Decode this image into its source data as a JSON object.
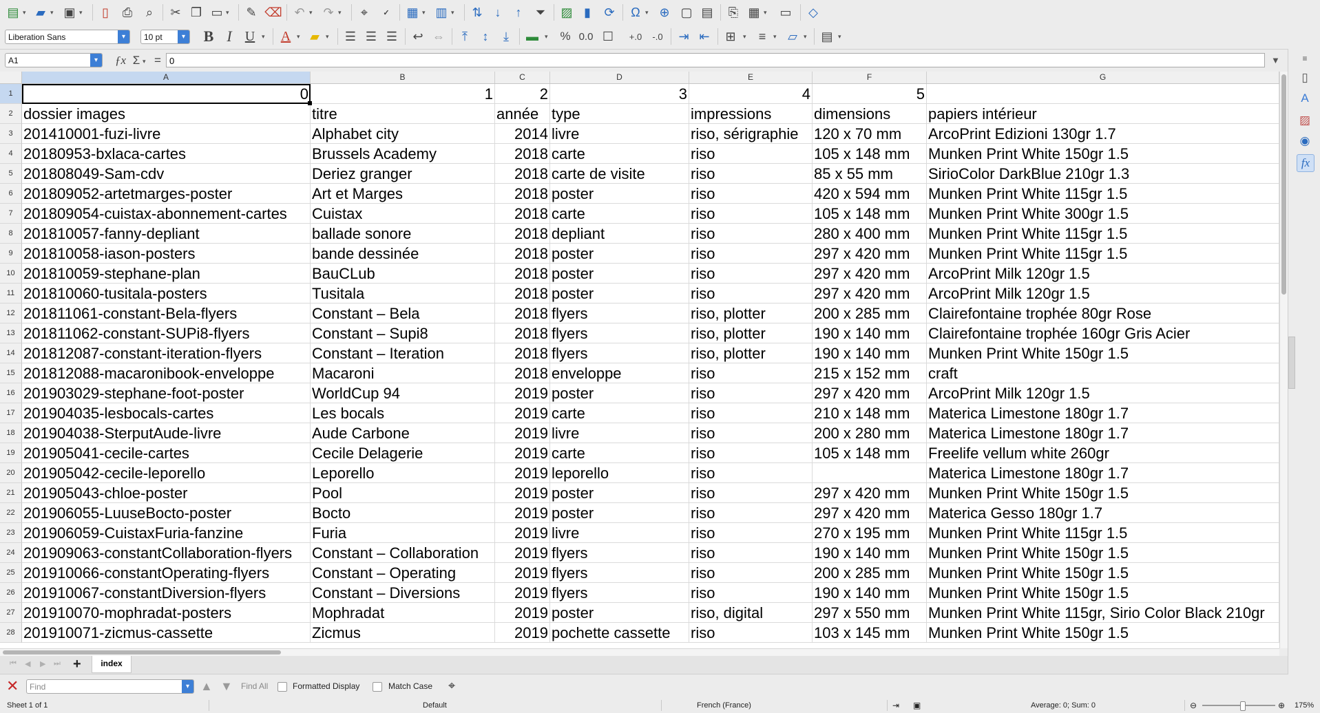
{
  "toolbar2": {
    "font_name": "Liberation Sans",
    "font_size": "10 pt"
  },
  "formula_bar": {
    "name_box": "A1",
    "content": "0"
  },
  "columns": [
    "A",
    "B",
    "C",
    "D",
    "E",
    "F",
    "G"
  ],
  "rows": [
    {
      "n": "1",
      "c": [
        "0",
        "1",
        "2",
        "3",
        "4",
        "5",
        ""
      ]
    },
    {
      "n": "2",
      "c": [
        "dossier images",
        "titre",
        "année",
        "type",
        "impressions",
        "dimensions",
        "papiers intérieur"
      ]
    },
    {
      "n": "3",
      "c": [
        "201410001-fuzi-livre",
        "Alphabet city",
        "2014",
        "livre",
        "riso, sérigraphie",
        "120 x 70 mm",
        "ArcoPrint Edizioni 130gr 1.7"
      ]
    },
    {
      "n": "4",
      "c": [
        "20180953-bxlaca-cartes",
        "Brussels Academy",
        "2018",
        "carte",
        "riso",
        "105 x 148 mm",
        "Munken Print White 150gr 1.5"
      ]
    },
    {
      "n": "5",
      "c": [
        "201808049-Sam-cdv",
        "Deriez granger",
        "2018",
        "carte de visite",
        "riso",
        "85 x 55 mm",
        "SirioColor DarkBlue 210gr 1.3"
      ]
    },
    {
      "n": "6",
      "c": [
        "201809052-artetmarges-poster",
        "Art et Marges",
        "2018",
        "poster",
        "riso",
        "420 x 594 mm",
        "Munken Print White 115gr 1.5"
      ]
    },
    {
      "n": "7",
      "c": [
        "201809054-cuistax-abonnement-cartes",
        "Cuistax",
        "2018",
        "carte",
        "riso",
        "105 x 148 mm",
        "Munken Print White 300gr 1.5"
      ]
    },
    {
      "n": "8",
      "c": [
        "201810057-fanny-depliant",
        "ballade sonore",
        "2018",
        "depliant",
        "riso",
        "280 x 400 mm",
        "Munken Print White 115gr 1.5"
      ]
    },
    {
      "n": "9",
      "c": [
        "201810058-iason-posters",
        "bande dessinée",
        "2018",
        "poster",
        "riso",
        "297 x 420 mm",
        "Munken Print White 115gr 1.5"
      ]
    },
    {
      "n": "10",
      "c": [
        "201810059-stephane-plan",
        "BauCLub",
        "2018",
        "poster",
        "riso",
        "297 x 420 mm",
        "ArcoPrint Milk 120gr 1.5"
      ]
    },
    {
      "n": "11",
      "c": [
        "201810060-tusitala-posters",
        "Tusitala",
        "2018",
        "poster",
        "riso",
        "297 x 420 mm",
        "ArcoPrint Milk 120gr 1.5"
      ]
    },
    {
      "n": "12",
      "c": [
        "201811061-constant-Bela-flyers",
        "Constant – Bela",
        "2018",
        "flyers",
        "riso, plotter",
        "200 x 285 mm",
        "Clairefontaine trophée 80gr Rose"
      ]
    },
    {
      "n": "13",
      "c": [
        "201811062-constant-SUPi8-flyers",
        "Constant – Supi8",
        "2018",
        "flyers",
        "riso, plotter",
        "190 x 140 mm",
        "Clairefontaine trophée 160gr Gris Acier"
      ]
    },
    {
      "n": "14",
      "c": [
        "201812087-constant-iteration-flyers",
        "Constant – Iteration",
        "2018",
        "flyers",
        "riso, plotter",
        "190 x 140 mm",
        "Munken Print White 150gr 1.5"
      ]
    },
    {
      "n": "15",
      "c": [
        "201812088-macaronibook-enveloppe",
        "Macaroni",
        "2018",
        "enveloppe",
        "riso",
        "215 x 152 mm",
        "craft"
      ]
    },
    {
      "n": "16",
      "c": [
        "201903029-stephane-foot-poster",
        "WorldCup 94",
        "2019",
        "poster",
        "riso",
        "297 x 420 mm",
        "ArcoPrint Milk 120gr 1.5"
      ]
    },
    {
      "n": "17",
      "c": [
        "201904035-lesbocals-cartes",
        "Les bocals",
        "2019",
        "carte",
        "riso",
        "210 x 148 mm",
        "Materica Limestone 180gr 1.7"
      ]
    },
    {
      "n": "18",
      "c": [
        "201904038-SterputAude-livre",
        "Aude Carbone",
        "2019",
        "livre",
        "riso",
        "200 x 280 mm",
        "Materica Limestone 180gr 1.7"
      ]
    },
    {
      "n": "19",
      "c": [
        "201905041-cecile-cartes",
        "Cecile Delagerie",
        "2019",
        "carte",
        "riso",
        "105 x 148 mm",
        "Freelife vellum white 260gr"
      ]
    },
    {
      "n": "20",
      "c": [
        "201905042-cecile-leporello",
        "Leporello",
        "2019",
        "leporello",
        "riso",
        "",
        "Materica Limestone 180gr 1.7"
      ]
    },
    {
      "n": "21",
      "c": [
        "201905043-chloe-poster",
        "Pool",
        "2019",
        "poster",
        "riso",
        "297 x 420 mm",
        "Munken Print White 150gr 1.5"
      ]
    },
    {
      "n": "22",
      "c": [
        "201906055-LuuseBocto-poster",
        "Bocto",
        "2019",
        "poster",
        "riso",
        "297 x 420 mm",
        "Materica Gesso 180gr 1.7"
      ]
    },
    {
      "n": "23",
      "c": [
        "201906059-CuistaxFuria-fanzine",
        "Furia",
        "2019",
        "livre",
        "riso",
        "270 x 195 mm",
        "Munken Print White 115gr 1.5"
      ]
    },
    {
      "n": "24",
      "c": [
        "201909063-constantCollaboration-flyers",
        "Constant – Collaboration",
        "2019",
        "flyers",
        "riso",
        "190 x 140 mm",
        "Munken Print White 150gr 1.5"
      ]
    },
    {
      "n": "25",
      "c": [
        "201910066-constantOperating-flyers",
        "Constant – Operating",
        "2019",
        "flyers",
        "riso",
        "200 x 285 mm",
        "Munken Print White 150gr 1.5"
      ]
    },
    {
      "n": "26",
      "c": [
        "201910067-constantDiversion-flyers",
        "Constant – Diversions",
        "2019",
        "flyers",
        "riso",
        "190 x 140 mm",
        "Munken Print White 150gr 1.5"
      ]
    },
    {
      "n": "27",
      "c": [
        "201910070-mophradat-posters",
        "Mophradat",
        "2019",
        "poster",
        "riso, digital",
        "297 x 550 mm",
        "Munken Print White 115gr, Sirio Color Black 210gr"
      ]
    },
    {
      "n": "28",
      "c": [
        "201910071-zicmus-cassette",
        "Zicmus",
        "2019",
        "pochette cassette",
        "riso",
        "103 x 145 mm",
        "Munken Print White 150gr 1.5"
      ]
    }
  ],
  "sheet_tabs": {
    "add": "+",
    "active": "index"
  },
  "find_bar": {
    "placeholder": "Find",
    "find_all": "Find All",
    "formatted_display": "Formatted Display",
    "match_case": "Match Case"
  },
  "status_bar": {
    "sheet": "Sheet 1 of 1",
    "style": "Default",
    "language": "French (France)",
    "summary": "Average: 0; Sum: 0",
    "zoom": "175%"
  }
}
